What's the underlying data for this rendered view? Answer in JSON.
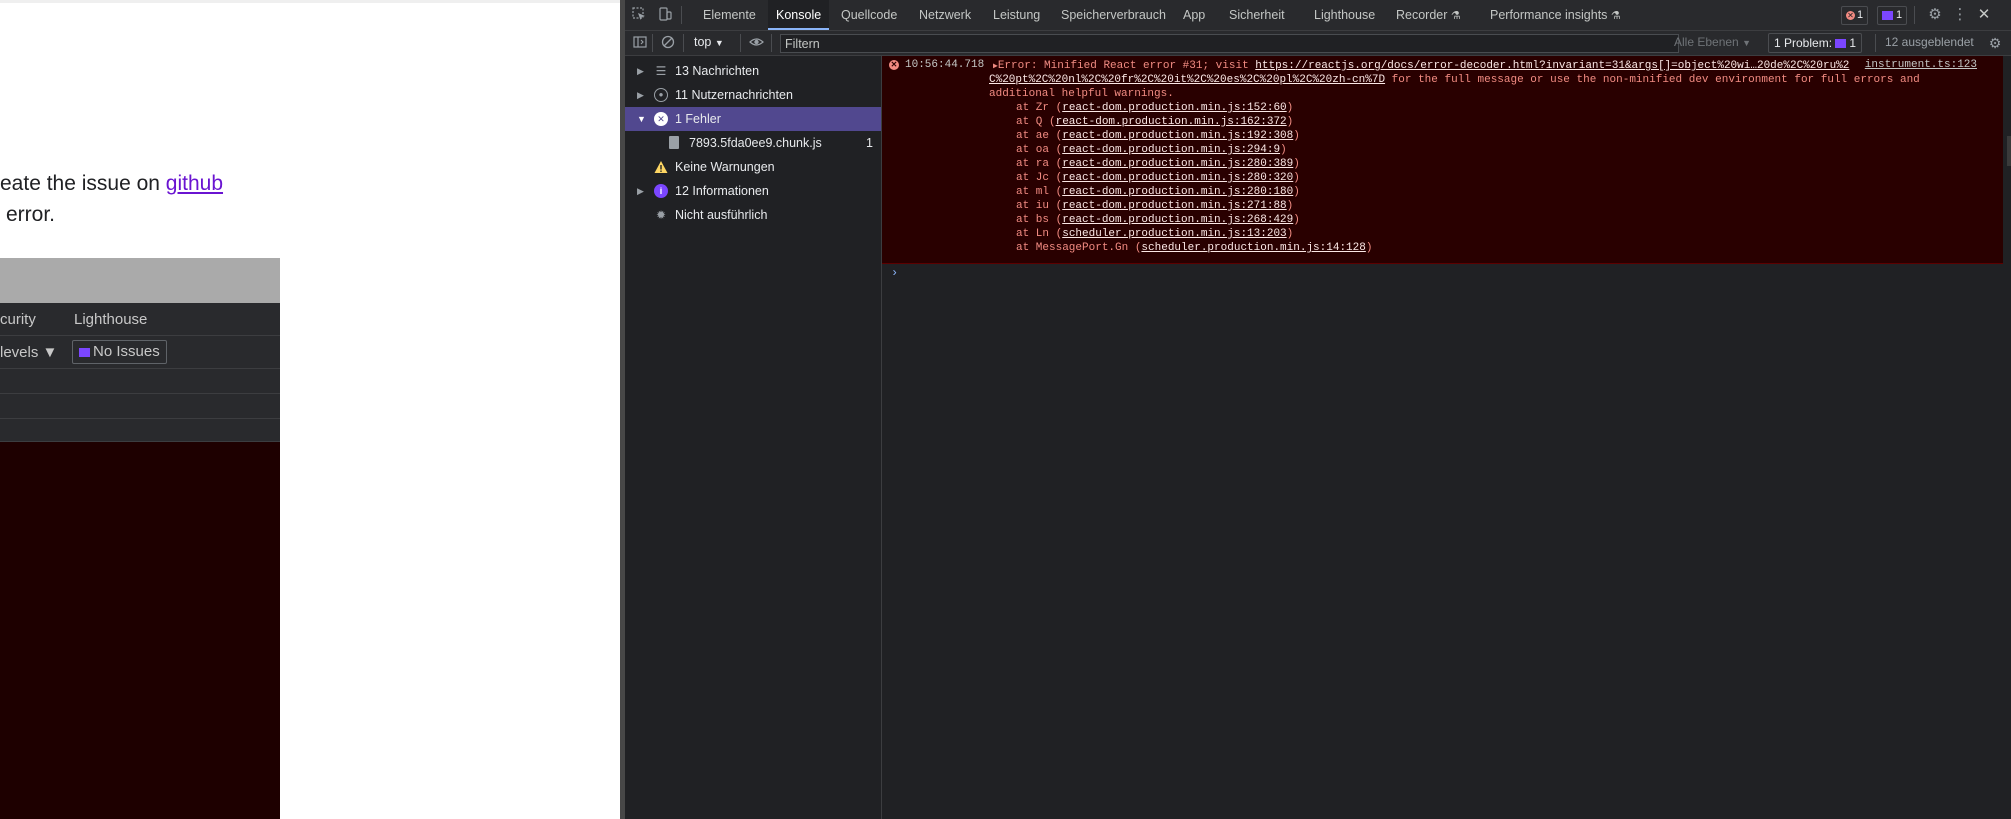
{
  "page": {
    "line1_prefix": "eate the issue on ",
    "line1_link": "github",
    "line2": "error.",
    "embedded_devtools": {
      "tabs": [
        "curity",
        "Lighthouse"
      ],
      "levels_label": "levels",
      "issues_label": "No Issues"
    }
  },
  "devtools": {
    "tabs": [
      {
        "label": "Elemente",
        "active": false
      },
      {
        "label": "Konsole",
        "active": true
      },
      {
        "label": "Quellcode",
        "active": false
      },
      {
        "label": "Netzwerk",
        "active": false
      },
      {
        "label": "Leistung",
        "active": false
      },
      {
        "label": "Speicherverbrauch",
        "active": false
      },
      {
        "label": "App",
        "active": false
      },
      {
        "label": "Sicherheit",
        "active": false
      },
      {
        "label": "Lighthouse",
        "active": false
      },
      {
        "label": "Recorder",
        "active": false
      },
      {
        "label": "Performance insights",
        "active": false
      }
    ],
    "error_count": "1",
    "message_count": "1",
    "toolbar": {
      "context": "top",
      "filter_placeholder": "Filtern",
      "levels": "Alle Ebenen",
      "problems_label": "1 Problem:",
      "problems_count": "1",
      "hidden": "12 ausgeblendet"
    },
    "sidebar": [
      {
        "label": "13 Nachrichten",
        "icon": "list-icon",
        "expandable": true,
        "selected": false,
        "count": ""
      },
      {
        "label": "11 Nutzernachrichten",
        "icon": "user-icon",
        "expandable": true,
        "selected": false,
        "count": ""
      },
      {
        "label": "1 Fehler",
        "icon": "error-icon",
        "expandable": true,
        "expanded": true,
        "selected": true,
        "count": ""
      },
      {
        "label": "7893.5fda0ee9.chunk.js",
        "icon": "file-icon",
        "expandable": false,
        "selected": false,
        "count": "1"
      },
      {
        "label": "Keine Warnungen",
        "icon": "warning-icon",
        "expandable": false,
        "selected": false,
        "count": ""
      },
      {
        "label": "12 Informationen",
        "icon": "info-icon",
        "expandable": true,
        "selected": false,
        "count": ""
      },
      {
        "label": "Nicht ausführlich",
        "icon": "bug-icon",
        "expandable": false,
        "selected": false,
        "count": ""
      }
    ],
    "console_error": {
      "timestamp": "10:56:44.718",
      "prefix": "Error: Minified React error #31; visit ",
      "url_part1": "https://reactjs.org/docs/error-decoder.html?invariant=31&args[]=object%20wi…20de%2C%20ru%2",
      "url_part2": "C%20pt%2C%20nl%2C%20fr%2C%20it%2C%20es%2C%20pl%2C%20zh-cn%7D",
      "suffix1": " for the full message or use the non-minified dev environment for full errors and",
      "suffix2": "additional helpful warnings.",
      "source": "instrument.ts:123",
      "stack": [
        {
          "fn": "at Zr",
          "loc": "react-dom.production.min.js:152:60"
        },
        {
          "fn": "at Q",
          "loc": "react-dom.production.min.js:162:372"
        },
        {
          "fn": "at ae",
          "loc": "react-dom.production.min.js:192:308"
        },
        {
          "fn": "at oa",
          "loc": "react-dom.production.min.js:294:9"
        },
        {
          "fn": "at ra",
          "loc": "react-dom.production.min.js:280:389"
        },
        {
          "fn": "at Jc",
          "loc": "react-dom.production.min.js:280:320"
        },
        {
          "fn": "at ml",
          "loc": "react-dom.production.min.js:280:180"
        },
        {
          "fn": "at iu",
          "loc": "react-dom.production.min.js:271:88"
        },
        {
          "fn": "at bs",
          "loc": "react-dom.production.min.js:268:429"
        },
        {
          "fn": "at Ln",
          "loc": "scheduler.production.min.js:13:203"
        },
        {
          "fn": "at MessagePort.Gn",
          "loc": "scheduler.production.min.js:14:128"
        }
      ]
    },
    "prompt_symbol": "›"
  }
}
